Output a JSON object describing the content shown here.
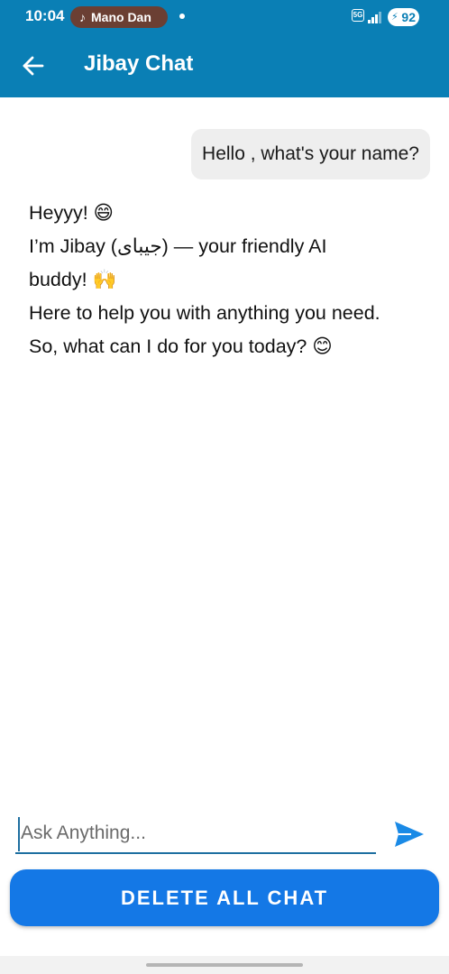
{
  "status_bar": {
    "time": "10:04",
    "media_label": "Mano Dan",
    "network": "5G",
    "battery": "92"
  },
  "app_bar": {
    "title": "Jibay Chat",
    "back_icon": "arrow-left-icon"
  },
  "messages": {
    "user": "Hello , what's your name?",
    "bot_lines": [
      "Heyyy! 😄",
      "I’m Jibay (جیبای) — your friendly AI",
      "buddy! 🙌",
      "Here to help you with anything you need.",
      "So, what can I do for you today? 😊"
    ]
  },
  "composer": {
    "placeholder": "Ask Anything...",
    "value": "",
    "send_icon": "send-icon"
  },
  "actions": {
    "delete_label": "DELETE ALL CHAT"
  },
  "colors": {
    "app_bar": "#0a7fb5",
    "button": "#1478e6",
    "send_icon": "#1a8ae6",
    "user_bubble": "#eeeeee"
  }
}
